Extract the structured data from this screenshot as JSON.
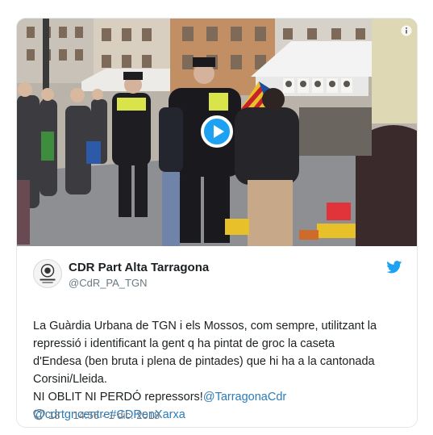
{
  "media": {
    "play_icon": "play-icon",
    "info_icon": "info-icon",
    "flag_colors": [
      "#e8c12a",
      "#c8202b",
      "#1c4fa0"
    ]
  },
  "tweet": {
    "display_name": "CDR Part Alta Tarragona",
    "handle": "@CdR_PA_TGN",
    "text_lines": [
      "La Guàrdia Urbana de TGN i els Mossos, com sempre, utilitzant la",
      "repressió i identificant la gent q ha pintat de groc la caseta",
      "d'Endesa (ben bruta i plena de pintades) que hi ha a la cantonada",
      "Corsini/Lleida."
    ],
    "line5_text": "NI OBLIT NI PERDÓ repressors!",
    "line5_link": "@TarragonaCdr",
    "line6_link1": "@cdrtgncentre",
    "line6_link2": "#CDRenXarxa",
    "likes": "18",
    "timestamp": "14:56 - 1 dic. 2018",
    "link_color": "#2b7bb9",
    "brand_color": "#1da1f2"
  }
}
